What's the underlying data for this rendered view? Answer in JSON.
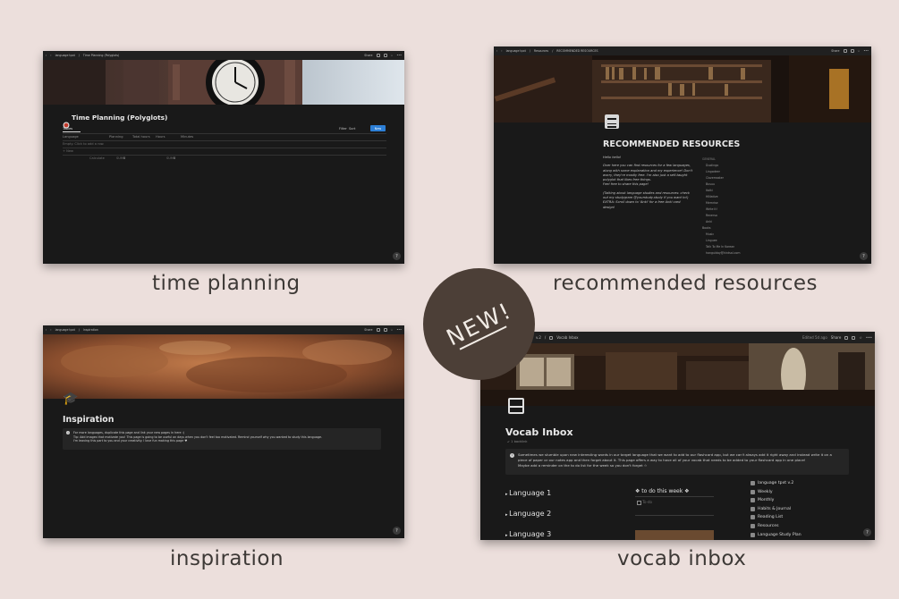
{
  "captions": {
    "time_planning": "time planning",
    "recommended_resources": "recommended resources",
    "inspiration": "inspiration",
    "vocab_inbox": "vocab inbox"
  },
  "badge": {
    "label": "NEW!"
  },
  "common": {
    "share": "Share",
    "help": "?"
  },
  "time_planning": {
    "breadcrumb_root": "language tpxt",
    "breadcrumb_page": "Time Planning (Polyglots)",
    "title": "Time Planning (Polyglots)",
    "view_tab": "Tables",
    "filter": "Filter",
    "sort": "Sort",
    "new_button": "New",
    "columns": [
      "Language",
      "Planning",
      "Total hours",
      "Hours",
      "Minutes"
    ],
    "row_placeholder": "Empty. Click to add a row.",
    "add_row": "+ New",
    "calc": [
      "Calculate",
      "SUM",
      "SUM"
    ],
    "calc_values": [
      "0",
      "0"
    ]
  },
  "resources": {
    "breadcrumb_root": "language tpxt",
    "breadcrumb_mid": "Resources",
    "breadcrumb_page": "RECOMMENDED RESOURCES",
    "title": "RECOMMENDED RESOURCES",
    "para1": [
      "Hello hello!",
      "Over here you can find resources for a few languages,",
      "along with some explanation and my experience! Don't",
      "worry, they're mostly free. I'm also just a self-taught",
      "polyglot that likes free things.",
      "Feel free to share this page!"
    ],
    "para2": [
      "(Talking about language studies and resources: check",
      "out my studygram @yourstudy.study if you want to!)",
      "EXTRA: Scroll down to 'Anki' for a free Anki card",
      "design!"
    ],
    "sidebar_heading": "GENERAL",
    "sidebar": [
      "Duolingo",
      "Lingodeer",
      "Clozemaster",
      "Busuu",
      "Italki",
      "HiNative",
      "Memrise",
      "Write it!",
      "Reverso",
      "Anki",
      "Books",
      "Music",
      "Linguee",
      "Talk To Me In Korean",
      "hangulday@hintsal.com"
    ]
  },
  "inspiration": {
    "breadcrumb_root": "language tpxt",
    "breadcrumb_page": "Inspiration",
    "title": "Inspiration",
    "callout": [
      "For more languages, duplicate this page and link your new pages in here :)",
      "Tip: Add images that motivate you! This page is going to be useful on days when you don't feel too motivated. Remind yourself why you wanted to study this language.",
      "I'm leaving this part to you and your creativity. I love fun making this page ♥"
    ]
  },
  "vocab": {
    "breadcrumb_root": "v.2",
    "breadcrumb_page": "Vocab Inbox",
    "edited": "Edited 5d ago",
    "title": "Vocab Inbox",
    "backlink": "1 backlink",
    "callout": [
      "Sometimes we stumble upon new interesting words in our target language that we want to add to our flashcard app, but we can't always add it right away and instead write it on a",
      "piece of paper or our notes app and then forget about it. This page offers a way to have all of your vocab that needs to be added to your flashcard app in one place!",
      "Maybe add a reminder on the to do list for the week so you don't forget ☆"
    ],
    "toggles": [
      "Language 1",
      "Language 2",
      "Language 3"
    ],
    "todo_heading": "❖ to do this week ❖",
    "todo_placeholder": "To-do",
    "links": [
      "language tpxt v.2",
      "Weekly",
      "Monthly",
      "Habits & Journal",
      "Reading List",
      "Resources",
      "Language Study Plan"
    ]
  }
}
